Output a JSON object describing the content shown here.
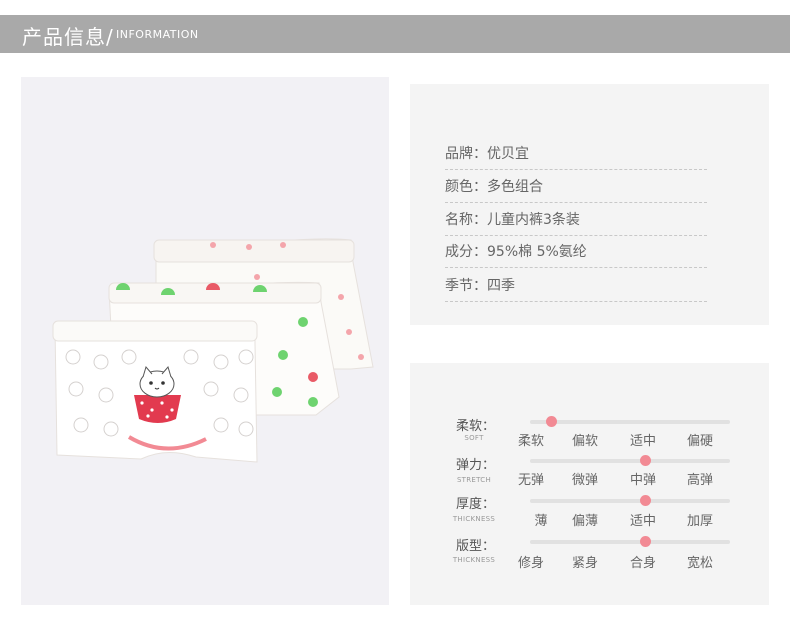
{
  "header": {
    "title": "产品信息/",
    "subtitle": "INFORMATION"
  },
  "info": [
    {
      "label": "品牌：优贝宜"
    },
    {
      "label": "颜色：多色组合"
    },
    {
      "label": "名称：儿童内裤3条装"
    },
    {
      "label": "成分：95%棉 5%氨纶"
    },
    {
      "label": "季节：四季"
    }
  ],
  "attributes": [
    {
      "label": "柔软：",
      "sub": "SOFT",
      "options": [
        "柔软",
        "偏软",
        "适中",
        "偏硬"
      ],
      "selected": 0
    },
    {
      "label": "弹力：",
      "sub": "STRETCH",
      "options": [
        "无弹",
        "微弹",
        "中弹",
        "高弹"
      ],
      "selected": 2
    },
    {
      "label": "厚度：",
      "sub": "THICKNESS",
      "options": [
        "薄",
        "偏薄",
        "适中",
        "加厚"
      ],
      "selected": 2
    },
    {
      "label": "版型：",
      "sub": "THICKNESS",
      "options": [
        "修身",
        "紧身",
        "合身",
        "宽松"
      ],
      "selected": 2
    }
  ],
  "colors": {
    "accent": "#f28a94",
    "header_bg": "#a9a9a9",
    "panel_bg": "#f4f4f4"
  }
}
